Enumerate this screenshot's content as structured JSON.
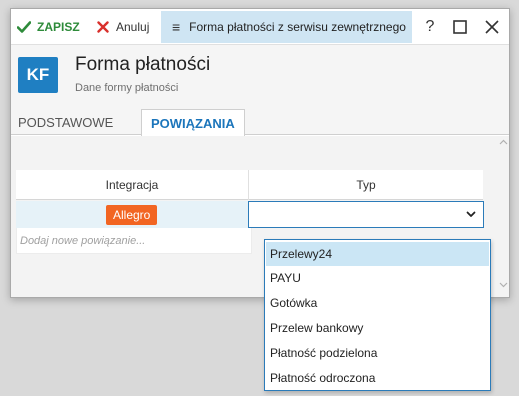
{
  "toolbar": {
    "save_label": "ZAPISZ",
    "cancel_label": "Anuluj",
    "window_title": "Forma płatności z serwisu zewnętrznego",
    "help_label": "?"
  },
  "header": {
    "avatar": "KF",
    "title": "Forma płatności",
    "subtitle": "Dane formy płatności"
  },
  "tabs": [
    {
      "label": "PODSTAWOWE",
      "active": false
    },
    {
      "label": "POWIĄZANIA",
      "active": true
    }
  ],
  "grid": {
    "columns": [
      "Integracja",
      "Typ"
    ],
    "rows": [
      {
        "integration": "Allegro",
        "type": ""
      }
    ],
    "add_placeholder": "Dodaj nowe powiązanie..."
  },
  "dropdown": {
    "options": [
      "Przelewy24",
      "PAYU",
      "Gotówka",
      "Przelew bankowy",
      "Płatność podzielona",
      "Płatność odroczona"
    ],
    "highlighted": "Przelewy24"
  },
  "colors": {
    "accent": "#1f7fc2",
    "save": "#2e8b3a",
    "cancel": "#d9302c",
    "badge": "#f26522",
    "title_bg": "#cfe5f3",
    "selected_option": "#cbe6f5"
  },
  "icons": {
    "save": "check-icon",
    "cancel": "x-icon",
    "menu": "hamburger-icon",
    "maximize": "square-icon",
    "close": "close-icon",
    "select": "chevron-down-icon"
  }
}
